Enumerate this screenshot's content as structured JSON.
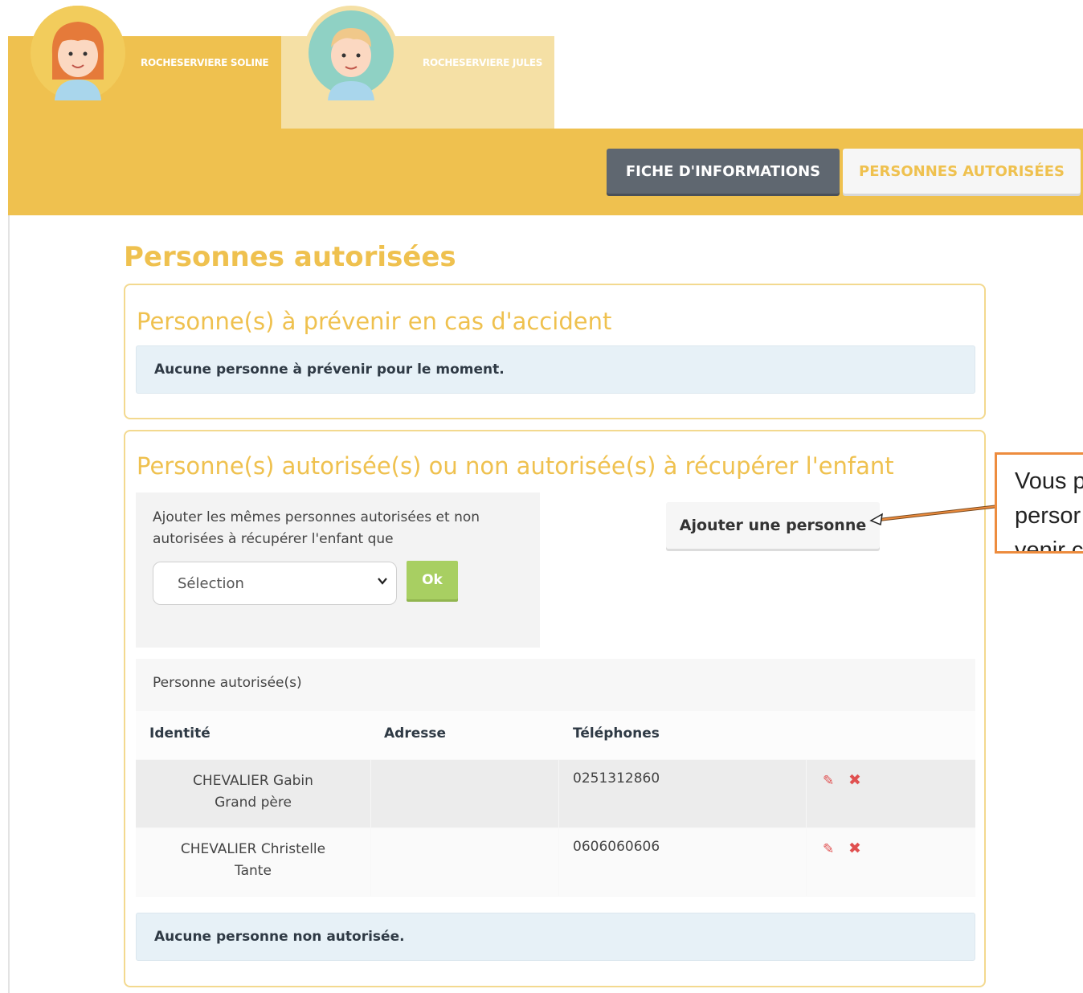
{
  "children_tabs": [
    {
      "name": "ROCHESERVIERE SOLINE",
      "active": true,
      "avatar": "girl-avatar-icon",
      "avatar_bg": "#efc14f"
    },
    {
      "name": "ROCHESERVIERE JULES",
      "active": false,
      "avatar": "boy-avatar-icon",
      "avatar_bg": "#8fd1c4"
    }
  ],
  "top_buttons": {
    "fiche": "FICHE D'INFORMATIONS",
    "personnes": "PERSONNES AUTORISÉES"
  },
  "page_title": "Personnes autorisées",
  "accident_section": {
    "title": "Personne(s) à prévenir en cas d'accident",
    "empty_message": "Aucune personne à prévenir pour le moment."
  },
  "autorisees_section": {
    "title": "Personne(s) autorisée(s) ou non autorisée(s) à récupérer l'enfant",
    "copy_text": "Ajouter les mêmes personnes autorisées et non autorisées à récupérer l'enfant que",
    "select_value": "Sélection",
    "ok_label": "Ok",
    "add_button": "Ajouter une personne",
    "table": {
      "caption": "Personne autorisée(s)",
      "headers": [
        "Identité",
        "Adresse",
        "Téléphones"
      ],
      "rows": [
        {
          "name": "CHEVALIER Gabin",
          "relation": "Grand père",
          "address": "",
          "phone": "0251312860"
        },
        {
          "name": "CHEVALIER Christelle",
          "relation": "Tante",
          "address": "",
          "phone": "0606060606"
        }
      ]
    },
    "non_autorisee_message": "Aucune personne non autorisée."
  },
  "callout": {
    "lines": [
      "Vous p",
      "persor",
      "venir c"
    ]
  },
  "colors": {
    "accent": "#efc14f",
    "dark_button": "#5f6770",
    "ok_green": "#a8cf62",
    "danger": "#e05050",
    "callout_border": "#ed8c3e"
  }
}
